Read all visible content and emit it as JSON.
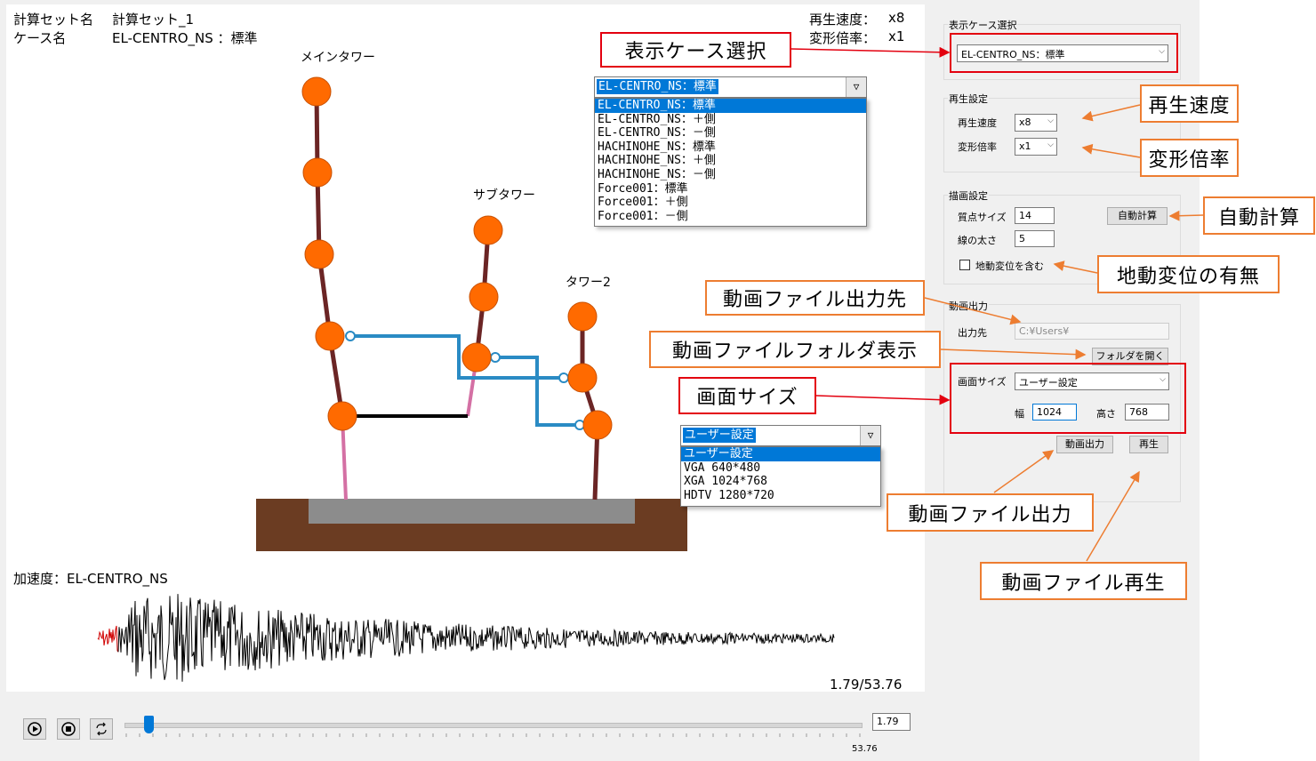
{
  "header": {
    "set_label": "計算セット名",
    "set_value": "計算セット_1",
    "case_label": "ケース名",
    "case_value": "EL-CENTRO_NS ：標準",
    "speed_label": "再生速度：",
    "speed_value": "x8",
    "scale_label": "変形倍率：",
    "scale_value": "x1"
  },
  "towers": {
    "main": "メインタワー",
    "sub": "サブタワー",
    "tower2": "タワー2"
  },
  "waveform": {
    "label": "加速度：EL-CENTRO_NS",
    "time": "1.79/53.76"
  },
  "player": {
    "play_icon": "play-icon",
    "stop_icon": "stop-icon",
    "loop_icon": "loop-icon",
    "current_time": "1.79",
    "max_time": "53.76",
    "progress": 0.033
  },
  "case_dropdown": {
    "selected": "EL-CENTRO_NS：標準",
    "options": [
      "EL-CENTRO_NS：標準",
      "EL-CENTRO_NS：＋側",
      "EL-CENTRO_NS：－側",
      "HACHINOHE_NS：標準",
      "HACHINOHE_NS：＋側",
      "HACHINOHE_NS：－側",
      "Force001：標準",
      "Force001：＋側",
      "Force001：－側"
    ]
  },
  "size_dropdown": {
    "selected": "ユーザー設定",
    "options": [
      "ユーザー設定",
      "VGA 640*480",
      "XGA 1024*768",
      "HDTV 1280*720"
    ]
  },
  "panel": {
    "case_group": "表示ケース選択",
    "case_value": "EL-CENTRO_NS：標準",
    "play_group": "再生設定",
    "speed_label": "再生速度",
    "speed_value": "x8",
    "scale_label": "変形倍率",
    "scale_value": "x1",
    "draw_group": "描画設定",
    "mass_size_label": "質点サイズ",
    "mass_size_value": "14",
    "line_width_label": "線の太さ",
    "line_width_value": "5",
    "auto_calc": "自動計算",
    "ground_disp": "地動変位を含む",
    "video_group": "動画出力",
    "output_label": "出力先",
    "output_value": "C:¥Users¥",
    "open_folder": "フォルダを開く",
    "screen_size_label": "画面サイズ",
    "screen_size_value": "ユーザー設定",
    "width_label": "幅",
    "width_value": "1024",
    "height_label": "高さ",
    "height_value": "768",
    "video_out": "動画出力",
    "play": "再生"
  },
  "callouts": {
    "case_select": "表示ケース選択",
    "speed": "再生速度",
    "scale": "変形倍率",
    "auto_calc": "自動計算",
    "ground": "地動変位の有無",
    "video_dest": "動画ファイル出力先",
    "folder_show": "動画ファイルフォルダ表示",
    "screen_size": "画面サイズ",
    "video_out": "動画ファイル出力",
    "video_play": "動画ファイル再生"
  },
  "colors": {
    "mass_fill": "#ff6a00",
    "column": "#6b2525",
    "beam_blue": "#2a8bc4",
    "beam_black": "#000000",
    "pink": "#d470a4",
    "ground": "#6b3c22",
    "slab": "#8c8c8c",
    "callout_orange": "#ed7d31",
    "callout_red": "#e3000f",
    "selection": "#0078d7"
  }
}
